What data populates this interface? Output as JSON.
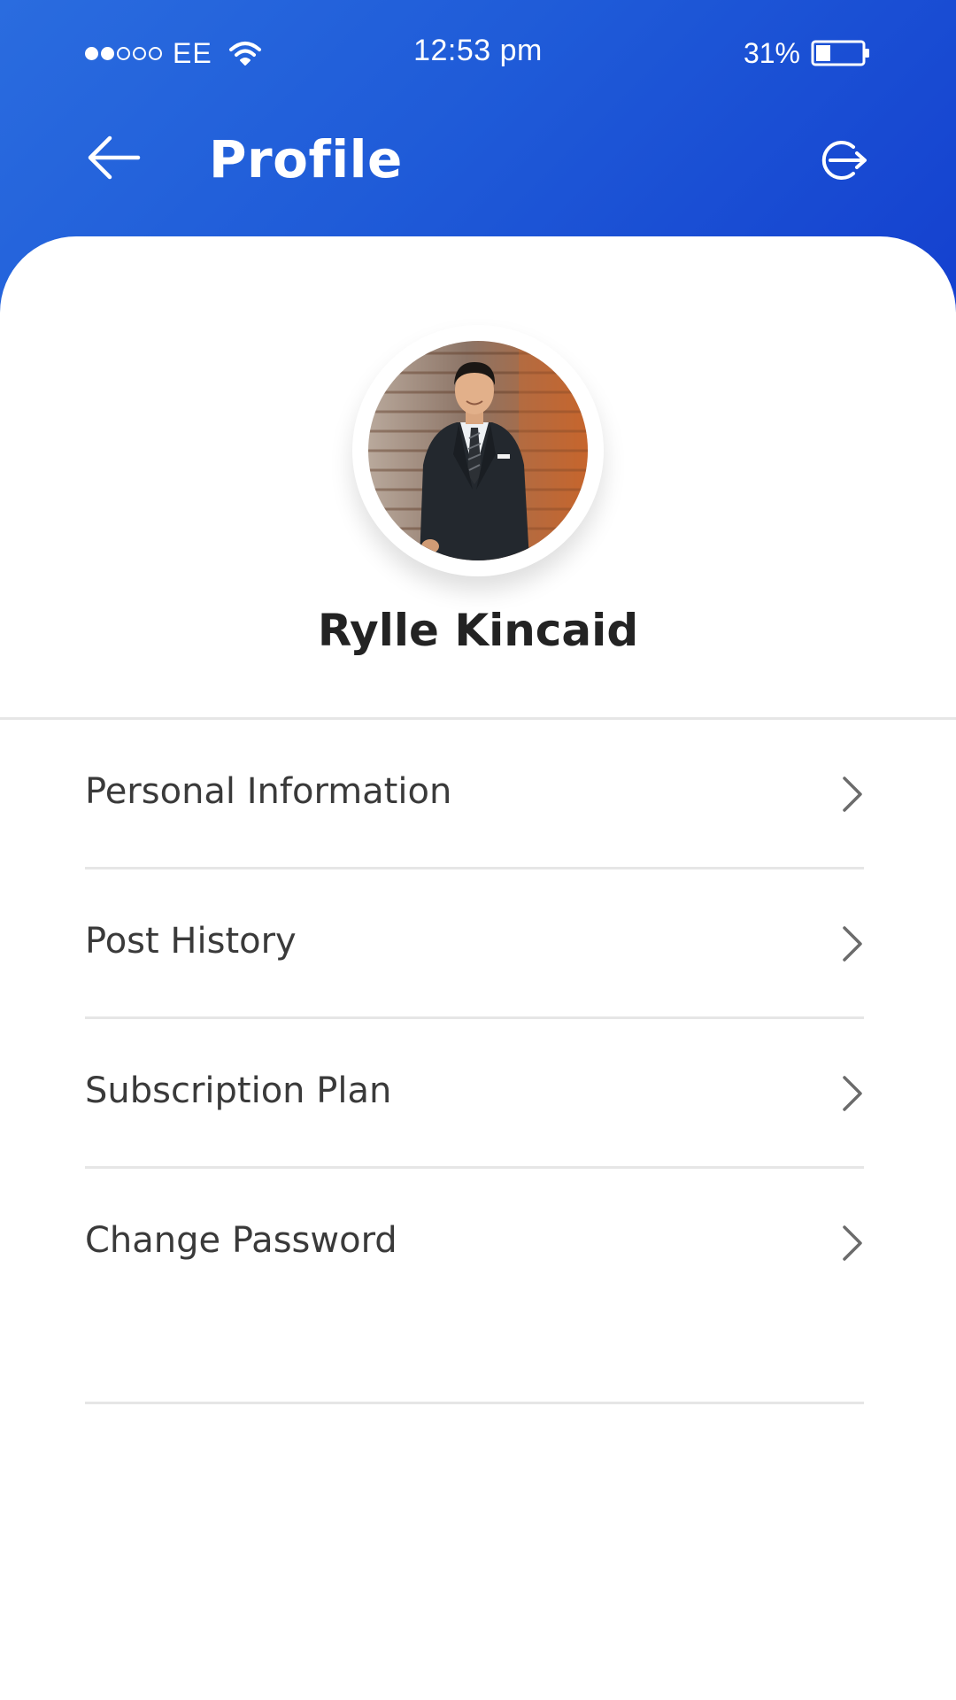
{
  "status_bar": {
    "carrier": "EE",
    "time": "12:53 pm",
    "battery_percent": "31%",
    "battery_level": 0.31,
    "signal_strength": 2,
    "signal_max": 5
  },
  "nav": {
    "title": "Profile",
    "back_icon": "arrow-left-icon",
    "logout_icon": "logout-icon"
  },
  "profile": {
    "name": "Rylle Kincaid"
  },
  "menu": {
    "items": [
      {
        "label": "Personal Information",
        "icon": "chevron-right-icon"
      },
      {
        "label": "Post History",
        "icon": "chevron-right-icon"
      },
      {
        "label": "Subscription Plan",
        "icon": "chevron-right-icon"
      },
      {
        "label": "Change Password",
        "icon": "chevron-right-icon"
      }
    ]
  },
  "colors": {
    "header_start": "#2a6cdf",
    "header_end": "#1440cf",
    "text_primary": "#232323",
    "text_menu": "#3a3a3a",
    "divider": "#e6e6e6"
  }
}
